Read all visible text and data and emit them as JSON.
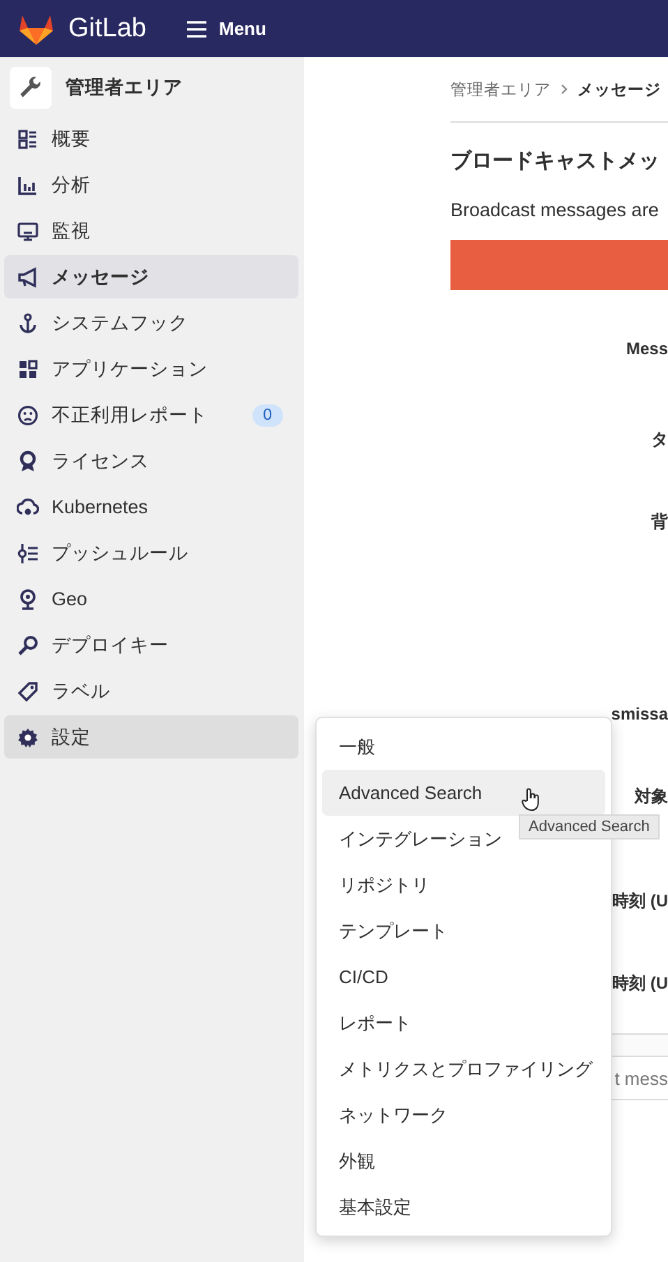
{
  "topbar": {
    "logo_text": "GitLab",
    "menu_label": "Menu"
  },
  "sidebar": {
    "header": "管理者エリア",
    "items": [
      {
        "label": "概要",
        "selected": false,
        "expanded": false
      },
      {
        "label": "分析",
        "selected": false,
        "expanded": false
      },
      {
        "label": "監視",
        "selected": false,
        "expanded": false
      },
      {
        "label": "メッセージ",
        "selected": true,
        "expanded": false
      },
      {
        "label": "システムフック",
        "selected": false,
        "expanded": false
      },
      {
        "label": "アプリケーション",
        "selected": false,
        "expanded": false
      },
      {
        "label": "不正利用レポート",
        "selected": false,
        "expanded": false,
        "badge": "0"
      },
      {
        "label": "ライセンス",
        "selected": false,
        "expanded": false
      },
      {
        "label": "Kubernetes",
        "selected": false,
        "expanded": false
      },
      {
        "label": "プッシュルール",
        "selected": false,
        "expanded": false
      },
      {
        "label": "Geo",
        "selected": false,
        "expanded": false
      },
      {
        "label": "デプロイキー",
        "selected": false,
        "expanded": false
      },
      {
        "label": "ラベル",
        "selected": false,
        "expanded": false
      },
      {
        "label": "設定",
        "selected": false,
        "expanded": true
      }
    ]
  },
  "breadcrumb": [
    "管理者エリア",
    "メッセージ"
  ],
  "title": "ブロードキャストメッ",
  "description": "Broadcast messages are",
  "form_labels": [
    "Mess",
    "タ",
    "背",
    "smissa",
    "対象",
    "時刻 (U",
    "時刻 (U"
  ],
  "table_text": "t mess",
  "flyout": {
    "items": [
      {
        "label": "一般",
        "selected": false
      },
      {
        "label": "Advanced Search",
        "selected": true
      },
      {
        "label": "インテグレーション",
        "selected": false
      },
      {
        "label": "リポジトリ",
        "selected": false
      },
      {
        "label": "テンプレート",
        "selected": false
      },
      {
        "label": "CI/CD",
        "selected": false
      },
      {
        "label": "レポート",
        "selected": false
      },
      {
        "label": "メトリクスとプロファイリング",
        "selected": false
      },
      {
        "label": "ネットワーク",
        "selected": false
      },
      {
        "label": "外観",
        "selected": false
      },
      {
        "label": "基本設定",
        "selected": false
      }
    ],
    "tooltip": "Advanced Search"
  }
}
